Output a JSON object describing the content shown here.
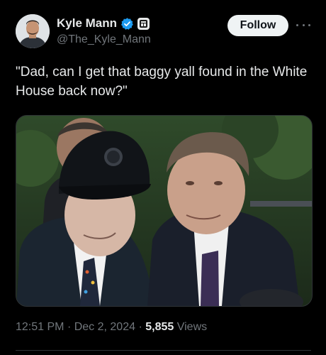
{
  "author": {
    "display_name": "Kyle Mann",
    "handle": "@The_Kyle_Mann",
    "verified_badge_color": "#1d9bf0"
  },
  "actions": {
    "follow_label": "Follow"
  },
  "post": {
    "text": "\"Dad, can I get that baggy yall found in the White House back now?\""
  },
  "meta": {
    "time": "12:51 PM",
    "separator": "·",
    "date": "Dec 2, 2024",
    "views_count": "5,855",
    "views_label": "Views"
  },
  "colors": {
    "background": "#000000",
    "text_primary": "#e7e9ea",
    "text_secondary": "#71767b",
    "follow_button_bg": "#eff3f4",
    "border": "#2f3336"
  },
  "icons": {
    "verified": "verified-checkmark-icon",
    "affiliation": "affiliation-badge-icon",
    "more": "more-options-icon"
  }
}
